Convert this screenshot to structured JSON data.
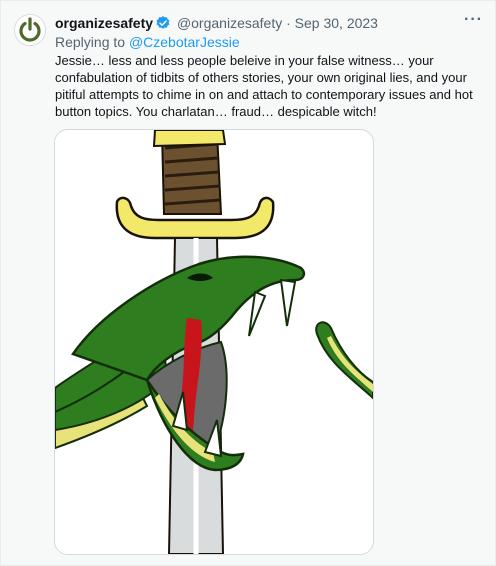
{
  "tweet": {
    "display_name": "organizesafety",
    "handle": "@organizesafety",
    "separator": "·",
    "date": "Sep 30, 2023",
    "replying_prefix": "Replying to",
    "replying_to": "@CzebotarJessie",
    "body": "Jessie… less and less people beleive in your false witness… your confabulation of tidbits of others stories, your own original lies, and your pitiful attempts to chime in on and attach to contemporary issues and hot button topics. You charlatan… fraud… despicable witch!",
    "more_label": "···"
  },
  "icons": {
    "avatar": "power-symbol-avatar-icon",
    "verified": "verified-badge-icon",
    "more": "more-options-icon"
  },
  "colors": {
    "verified_blue": "#1d9bf0",
    "link_blue": "#1d9bf0",
    "muted": "#536471",
    "snake_green": "#2e7d1f",
    "snake_belly": "#e8e27a",
    "hilt_gold": "#f2e96a",
    "grip_brown": "#6b5130",
    "blood_red": "#c8141b"
  },
  "media": {
    "image": "illustration of a green snake with fangs wrapped around a sword"
  }
}
